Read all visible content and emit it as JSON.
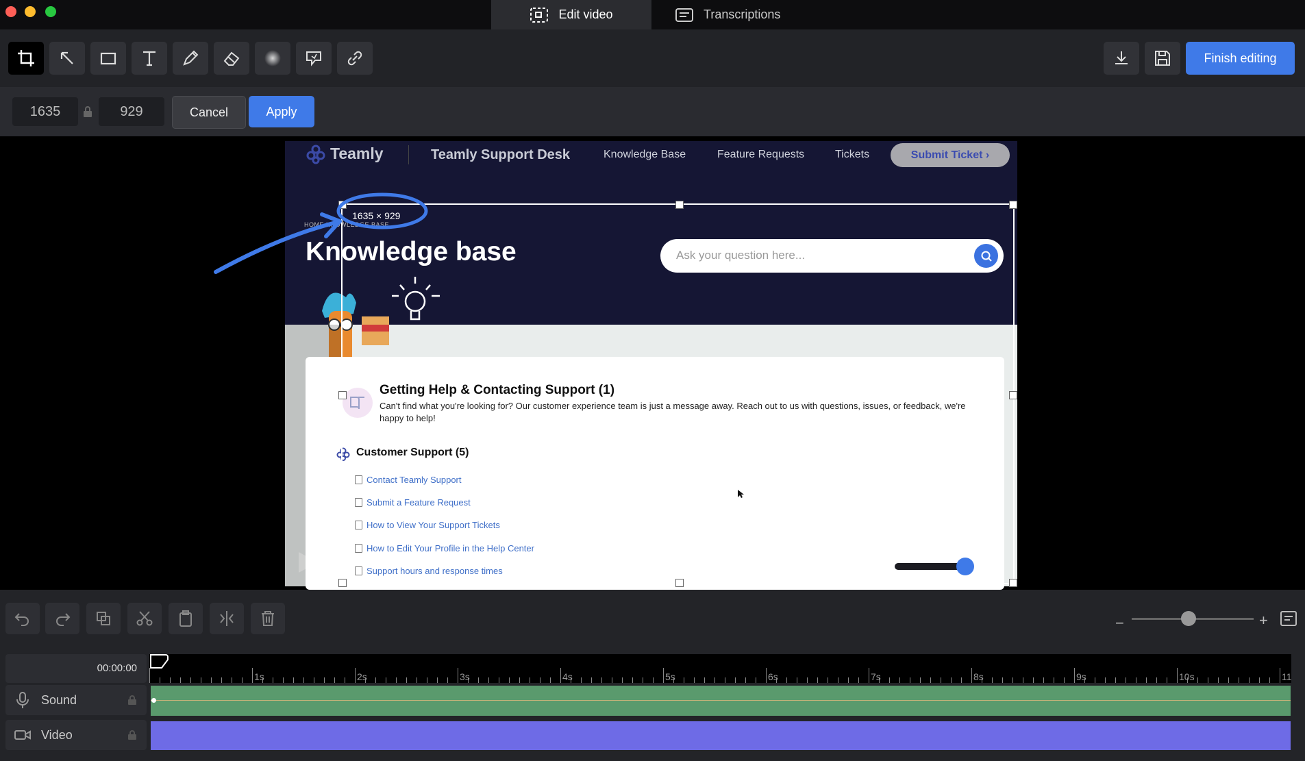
{
  "tabs": [
    {
      "label": "Edit video",
      "active": true,
      "icon": "edit-video-icon"
    },
    {
      "label": "Transcriptions",
      "active": false,
      "icon": "transcriptions-icon"
    }
  ],
  "toolbar": {
    "tools": [
      "crop-icon",
      "arrow-icon",
      "rectangle-icon",
      "text-icon",
      "pen-icon",
      "eraser-icon",
      "blur-icon",
      "callout-icon",
      "link-icon"
    ],
    "finish_label": "Finish editing"
  },
  "crop": {
    "width": "1635",
    "height": "929",
    "cancel_label": "Cancel",
    "apply_label": "Apply",
    "size_label": "1635 × 929"
  },
  "site": {
    "brand": "Teamly",
    "desk": "Teamly Support Desk",
    "nav": [
      "Knowledge Base",
      "Feature Requests",
      "Tickets"
    ],
    "cta": "Submit Ticket ›",
    "breadcrumb": "HOME  KNOWLEDGE BASE",
    "hero_title": "Knowledge base",
    "search_placeholder": "Ask your question here...",
    "section_title": "Getting Help & Contacting Support (1)",
    "section_desc": "Can't find what you're looking for? Our customer experience team is just a message away. Reach out to us with questions, issues, or feedback, we're happy to help!",
    "category": "Customer Support (5)",
    "articles": [
      "Contact Teamly Support",
      "Submit a Feature Request",
      "How to View Your Support Tickets",
      "How to Edit Your Profile in the Help Center",
      "Support hours and response times"
    ]
  },
  "timeline": {
    "time": "00:00:00",
    "ticks": [
      "1s",
      "2s",
      "3s",
      "4s",
      "5s",
      "6s",
      "7s",
      "8s",
      "9s",
      "10s",
      "11"
    ],
    "tracks": [
      {
        "label": "Sound",
        "icon": "microphone-icon",
        "color": "#5a9a6d"
      },
      {
        "label": "Video",
        "icon": "video-camera-icon",
        "color": "#6e6be6"
      }
    ]
  },
  "colors": {
    "accent": "#3f7ae8",
    "hero": "#151634"
  }
}
